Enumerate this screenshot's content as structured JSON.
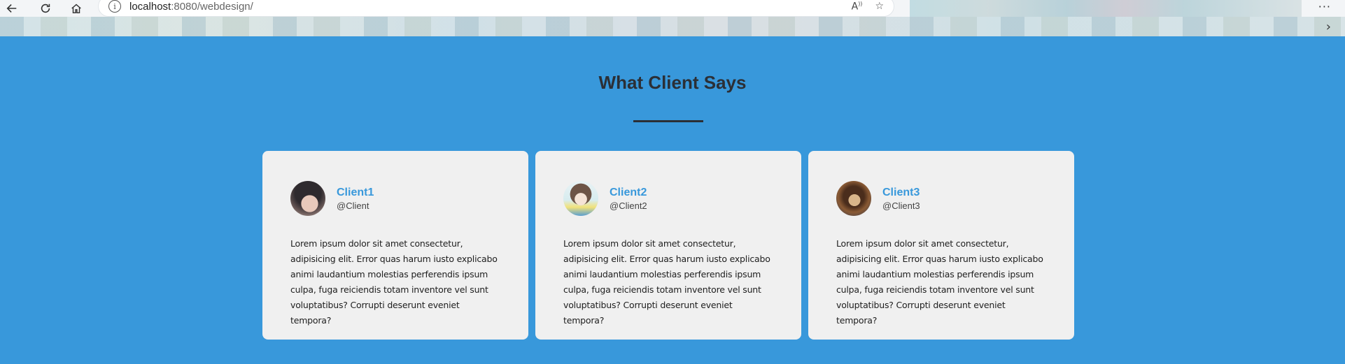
{
  "browser": {
    "url_host": "localhost",
    "url_rest": ":8080/webdesign/",
    "icons": [
      "back-arrow-icon",
      "reload-icon",
      "home-icon",
      "site-info-icon",
      "read-aloud-icon",
      "add-favorite-icon",
      "more-menu-icon",
      "chevron-right-icon"
    ]
  },
  "section": {
    "title": "What Client Says"
  },
  "testimonials": [
    {
      "name": "Client1",
      "handle": "@Client",
      "text": "Lorem ipsum dolor sit amet consectetur, adipisicing elit. Error quas harum iusto explicabo animi laudantium molestias perferendis ipsum culpa, fuga reiciendis totam inventore vel sunt voluptatibus? Corrupti deserunt eveniet tempora?"
    },
    {
      "name": "Client2",
      "handle": "@Client2",
      "text": "Lorem ipsum dolor sit amet consectetur, adipisicing elit. Error quas harum iusto explicabo animi laudantium molestias perferendis ipsum culpa, fuga reiciendis totam inventore vel sunt voluptatibus? Corrupti deserunt eveniet tempora?"
    },
    {
      "name": "Client3",
      "handle": "@Client3",
      "text": "Lorem ipsum dolor sit amet consectetur, adipisicing elit. Error quas harum iusto explicabo animi laudantium molestias perferendis ipsum culpa, fuga reiciendis totam inventore vel sunt voluptatibus? Corrupti deserunt eveniet tempora?"
    }
  ],
  "colors": {
    "page_background": "#3898db",
    "card_background": "#f0f0f0",
    "accent": "#3898db",
    "title": "#2b2f36"
  }
}
